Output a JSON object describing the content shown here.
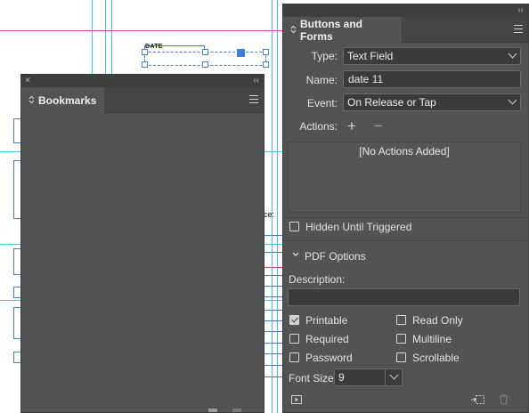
{
  "document": {
    "date_field_label": "DATE",
    "fragment_text": "ce:"
  },
  "bookmarks_panel": {
    "tab_label": "Bookmarks",
    "close_glyph": "×",
    "collapse_glyph": "‹‹"
  },
  "buttons_forms_panel": {
    "tab_label": "Buttons and Forms",
    "collapse_glyph": "‹‹",
    "type_label": "Type:",
    "type_value": "Text Field",
    "name_label": "Name:",
    "name_value": "date 11",
    "event_label": "Event:",
    "event_value": "On Release or Tap",
    "actions_label": "Actions:",
    "add_action_glyph": "+",
    "remove_action_glyph": "−",
    "actions_empty_text": "[No Actions Added]",
    "hidden_until_triggered_label": "Hidden Until Triggered",
    "hidden_until_triggered_checked": false,
    "pdf_options_label": "PDF Options",
    "description_label": "Description:",
    "description_value": "",
    "options": [
      {
        "label": "Printable",
        "checked": true
      },
      {
        "label": "Read Only",
        "checked": false
      },
      {
        "label": "Required",
        "checked": false
      },
      {
        "label": "Multiline",
        "checked": false
      },
      {
        "label": "Password",
        "checked": false
      },
      {
        "label": "Scrollable",
        "checked": false
      }
    ],
    "font_size_label": "Font Size:",
    "font_size_value": "9"
  },
  "colors": {
    "panel_bg": "#535353",
    "panel_dark": "#3b3b3b",
    "guide_cyan": "#43c2e6",
    "guide_magenta": "#d34ab8",
    "frame_blue": "#4a70c8",
    "selection_blue": "#3f7fe0"
  }
}
